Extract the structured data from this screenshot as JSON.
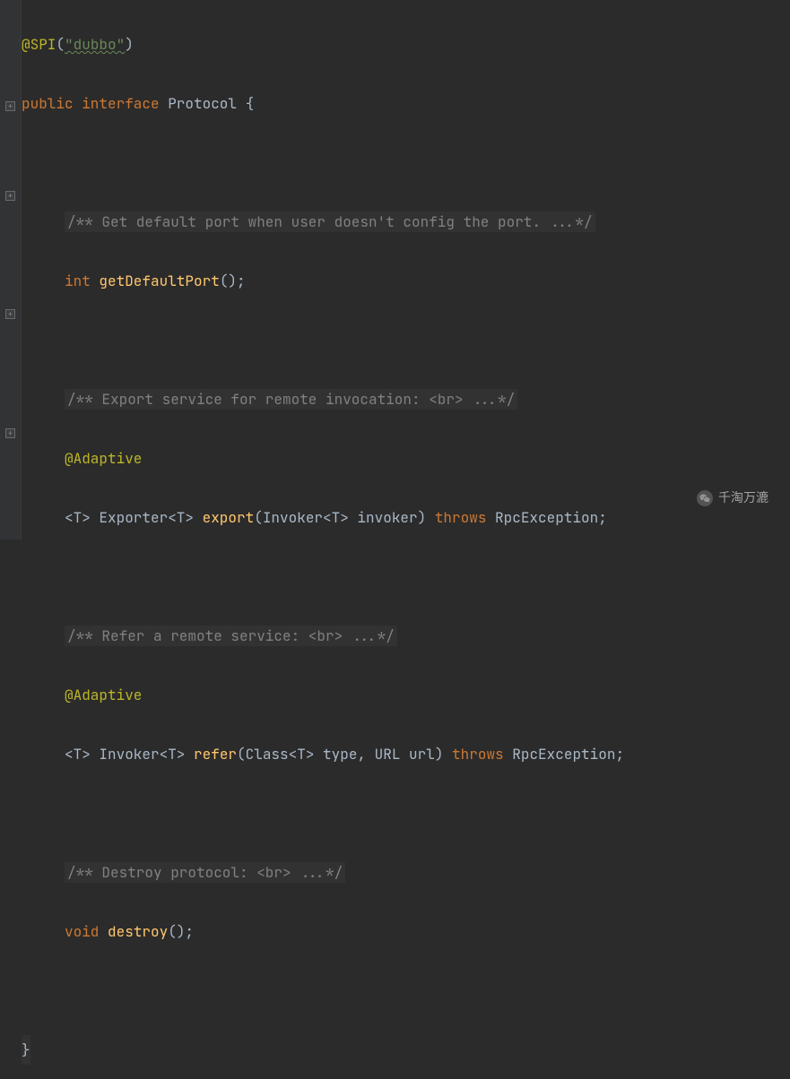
{
  "code": {
    "l1_annotation": "@SPI",
    "l1_paren_open": "(",
    "l1_string": "\"dubbo\"",
    "l1_paren_close": ")",
    "l2_modifier": "public interface ",
    "l2_class": "Protocol ",
    "l2_brace": "{",
    "l4_doc": "/** Get default port when user doesn't config the port. ...*/",
    "l5_type": "int ",
    "l5_method": "getDefaultPort",
    "l5_rest": "();",
    "l7_doc": "/** Export service for remote invocation: <br> ...*/",
    "l8_annotation": "@Adaptive",
    "l9_generic": "<T> ",
    "l9_ret": "Exporter<T> ",
    "l9_method": "export",
    "l9_params": "(Invoker<T> invoker) ",
    "l9_throws": "throws ",
    "l9_exc": "RpcException;",
    "l11_doc": "/** Refer a remote service: <br> ...*/",
    "l12_annotation": "@Adaptive",
    "l13_generic": "<T> ",
    "l13_ret": "Invoker<T> ",
    "l13_method": "refer",
    "l13_params": "(Class<T> type, URL url) ",
    "l13_throws": "throws ",
    "l13_exc": "RpcException;",
    "l15_doc": "/** Destroy protocol: <br> ...*/",
    "l16_type": "void ",
    "l16_method": "destroy",
    "l16_rest": "();",
    "l18_brace": "}"
  },
  "fold_positions": [
    113,
    213,
    345,
    478
  ],
  "watermark": {
    "text": "千淘万漉",
    "icon": "wechat-icon"
  }
}
